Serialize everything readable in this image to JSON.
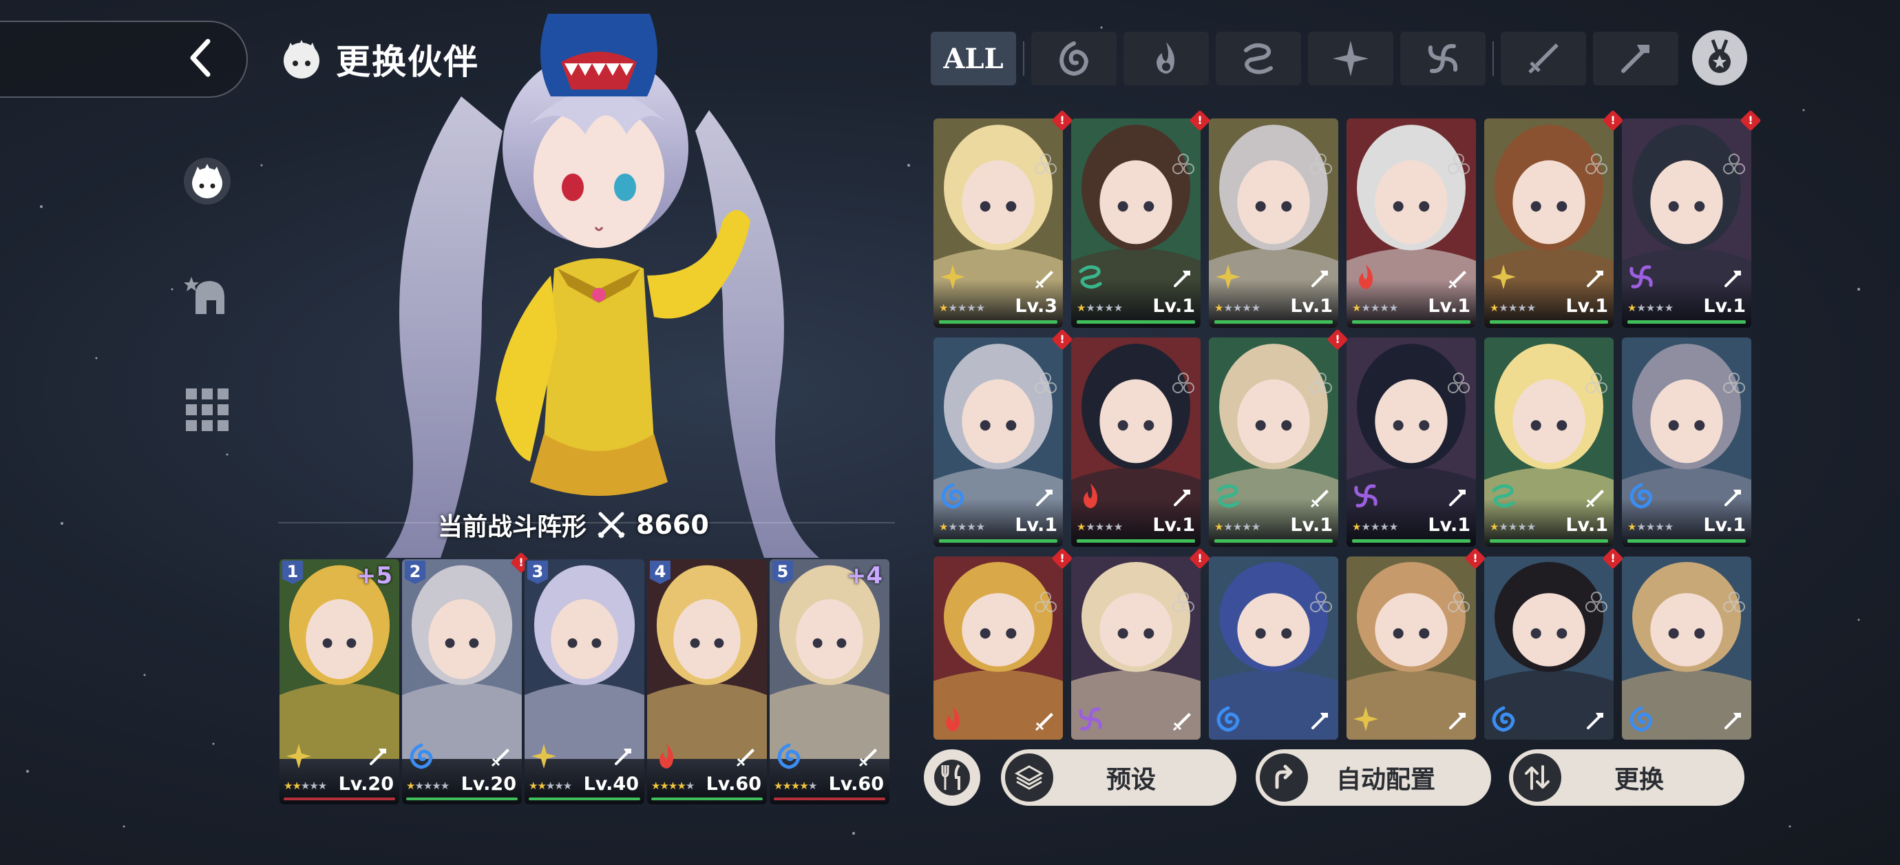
{
  "header": {
    "title": "更换伙伴"
  },
  "showcase": {
    "formation_label": "当前战斗阵形",
    "combat_power": "8660"
  },
  "tabs": {
    "all_label": "ALL",
    "items": [
      "water-element-icon",
      "fire-element-icon",
      "wind-element-icon",
      "light-element-icon",
      "dark-element-icon",
      "sword-role-icon",
      "hammer-role-icon"
    ],
    "medal_icon": "medal-icon"
  },
  "team": [
    {
      "slot": "1",
      "plus": "+5",
      "level": "Lv.20",
      "stars": 2,
      "element": "light",
      "role": "hammer",
      "bar": "#b5303b",
      "bg": "#3c5a2f",
      "hair": "#e2b74a"
    },
    {
      "slot": "2",
      "plus": "",
      "level": "Lv.20",
      "stars": 1,
      "element": "water",
      "role": "sword",
      "bar": "#3fbe5a",
      "bg": "#6a7590",
      "hair": "#c9c7cf"
    },
    {
      "slot": "3",
      "plus": "",
      "level": "Lv.40",
      "stars": 2,
      "element": "light",
      "role": "hammer",
      "bar": "#3fbe5a",
      "bg": "#2f3c55",
      "hair": "#c6c4e0"
    },
    {
      "slot": "4",
      "plus": "",
      "level": "Lv.60",
      "stars": 4,
      "element": "fire",
      "role": "sword",
      "bar": "#3fbe5a",
      "bg": "#3b2528",
      "hair": "#e8c470"
    },
    {
      "slot": "5",
      "plus": "+4",
      "level": "Lv.60",
      "stars": 4,
      "element": "water",
      "role": "sword",
      "bar": "#b5303b",
      "bg": "#5b6377",
      "hair": "#e3cfa8"
    }
  ],
  "roster": [
    {
      "level": "Lv.3",
      "element": "light",
      "role": "sword",
      "bg": "#6b6440",
      "hair": "#ecd9a0",
      "alert": true
    },
    {
      "level": "Lv.1",
      "element": "wind",
      "role": "hammer",
      "bg": "#2f5d45",
      "hair": "#4a3328",
      "alert": true
    },
    {
      "level": "Lv.1",
      "element": "light",
      "role": "hammer",
      "bg": "#6b6440",
      "hair": "#c7c3c5",
      "alert": false
    },
    {
      "level": "Lv.1",
      "element": "fire",
      "role": "sword",
      "bg": "#6e2a2e",
      "hair": "#dcdcdc",
      "alert": false
    },
    {
      "level": "Lv.1",
      "element": "light",
      "role": "hammer",
      "bg": "#6b6440",
      "hair": "#8a5230",
      "alert": true
    },
    {
      "level": "Lv.1",
      "element": "dark",
      "role": "hammer",
      "bg": "#3d3049",
      "hair": "#2a2f3d",
      "alert": true
    },
    {
      "level": "Lv.1",
      "element": "water",
      "role": "hammer",
      "bg": "#355068",
      "hair": "#b9bcc8",
      "alert": true
    },
    {
      "level": "Lv.1",
      "element": "fire",
      "role": "hammer",
      "bg": "#6e2a2e",
      "hair": "#1f2230",
      "alert": false
    },
    {
      "level": "Lv.1",
      "element": "wind",
      "role": "sword",
      "bg": "#2f5d45",
      "hair": "#d9c7a8",
      "alert": true
    },
    {
      "level": "Lv.1",
      "element": "dark",
      "role": "hammer",
      "bg": "#3d3049",
      "hair": "#1d2030",
      "alert": false
    },
    {
      "level": "Lv.1",
      "element": "wind",
      "role": "sword",
      "bg": "#2f5d45",
      "hair": "#f0dc90",
      "alert": false
    },
    {
      "level": "Lv.1",
      "element": "water",
      "role": "hammer",
      "bg": "#355068",
      "hair": "#8e8ea0",
      "alert": false
    },
    {
      "level": "",
      "element": "fire",
      "role": "sword",
      "bg": "#6e2a2e",
      "hair": "#d9a848",
      "alert": true
    },
    {
      "level": "",
      "element": "dark",
      "role": "sword",
      "bg": "#3d3049",
      "hair": "#e5d2b0",
      "alert": true
    },
    {
      "level": "",
      "element": "water",
      "role": "hammer",
      "bg": "#355068",
      "hair": "#3b4f9a",
      "alert": false
    },
    {
      "level": "",
      "element": "light",
      "role": "hammer",
      "bg": "#6b6440",
      "hair": "#c79a6c",
      "alert": true
    },
    {
      "level": "",
      "element": "water",
      "role": "hammer",
      "bg": "#355068",
      "hair": "#1f1c22",
      "alert": true
    },
    {
      "level": "",
      "element": "water",
      "role": "hammer",
      "bg": "#355068",
      "hair": "#c9a878",
      "alert": false
    }
  ],
  "buttons": {
    "preset": "预设",
    "auto": "自动配置",
    "replace": "更换"
  },
  "colors": {
    "water": "#3c8df2",
    "fire": "#e8413a",
    "wind": "#39b58c",
    "light": "#e3c34a",
    "dark": "#9c5fe0",
    "green_bar": "#3fbe5a",
    "red_bar": "#b5303b",
    "button_bg": "#e6e0d8"
  }
}
